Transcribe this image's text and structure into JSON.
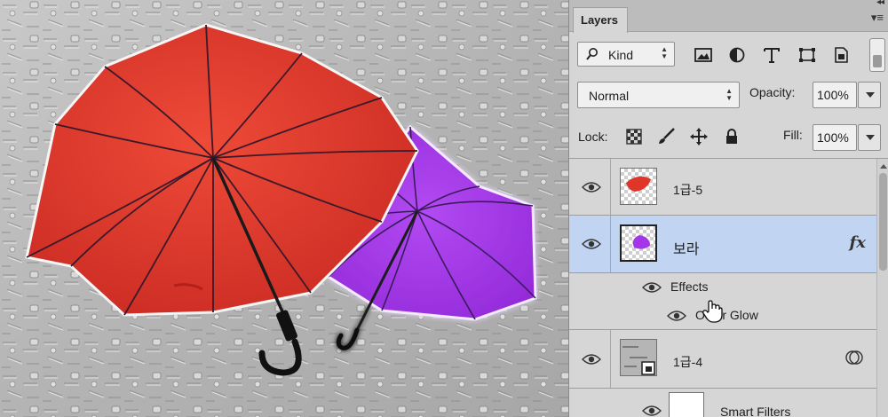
{
  "panel": {
    "tab_label": "Layers",
    "collapse_glyph": "◂◂",
    "menu_glyph": "▾≡"
  },
  "filter": {
    "kind_label": "Kind",
    "icons": [
      "image-filter-icon",
      "adjustment-filter-icon",
      "type-filter-icon",
      "shape-filter-icon",
      "smart-object-filter-icon"
    ]
  },
  "blend": {
    "mode": "Normal",
    "opacity_label": "Opacity:",
    "opacity_value": "100%"
  },
  "lock": {
    "label": "Lock:",
    "icons": [
      "lock-transparent-icon",
      "lock-image-icon",
      "lock-position-icon",
      "lock-all-icon"
    ],
    "fill_label": "Fill:",
    "fill_value": "100%"
  },
  "layers": [
    {
      "name": "1급-5",
      "visible": true,
      "selected": false,
      "thumb": "red-umbrella"
    },
    {
      "name": "보라",
      "visible": true,
      "selected": true,
      "thumb": "purple-umbrella",
      "fx": "fx",
      "effects_label": "Effects",
      "effect_name": "Outer Glow"
    },
    {
      "name": "1급-4",
      "visible": true,
      "selected": false,
      "thumb": "smart-object",
      "smart_filters_label": "Smart Filters"
    }
  ],
  "colors": {
    "selected_row": "#c1d4f1",
    "panel_bg": "#d6d6d6",
    "red_umbrella": "#e0352a",
    "purple_umbrella": "#a435e8"
  }
}
